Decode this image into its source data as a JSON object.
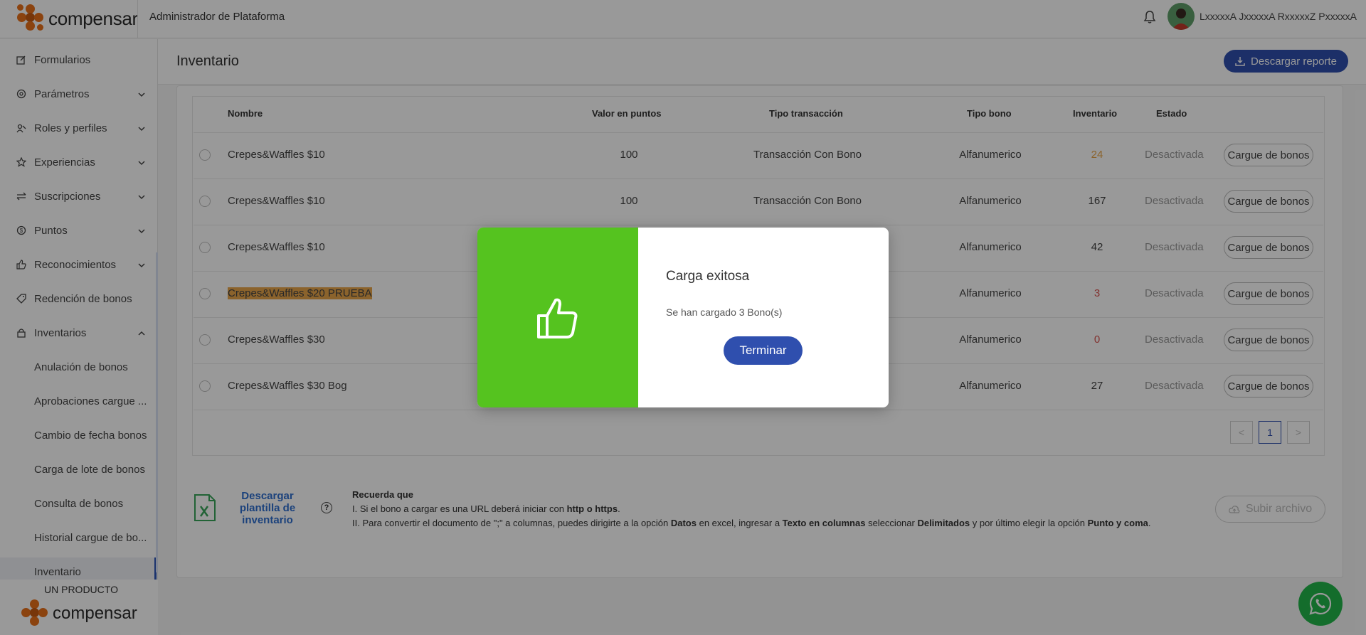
{
  "header": {
    "brand": "compensar",
    "app_title": "Administrador de Plataforma",
    "user_name": "LxxxxxA JxxxxxA RxxxxxZ PxxxxxA"
  },
  "sidebar": {
    "items": [
      {
        "label": "Formularios",
        "icon": "edit-icon"
      },
      {
        "label": "Parámetros",
        "icon": "gear-icon"
      },
      {
        "label": "Roles y perfiles",
        "icon": "users-icon"
      },
      {
        "label": "Experiencias",
        "icon": "star-icon"
      },
      {
        "label": "Suscripciones",
        "icon": "swap-icon"
      },
      {
        "label": "Puntos",
        "icon": "coin-icon"
      },
      {
        "label": "Reconocimientos",
        "icon": "thumbs-up-icon"
      },
      {
        "label": "Redención de bonos",
        "icon": "tag-icon"
      },
      {
        "label": "Inventarios",
        "icon": "lock-icon"
      }
    ],
    "subitems": [
      "Anulación de bonos",
      "Aprobaciones cargue ...",
      "Cambio de fecha bonos",
      "Carga de lote de bonos",
      "Consulta de bonos",
      "Historial cargue de bo...",
      "Inventario"
    ],
    "footer_label": "UN PRODUCTO",
    "footer_brand": "compensar"
  },
  "main": {
    "page_title": "Inventario",
    "download_report": "Descargar reporte",
    "columns": [
      "Nombre",
      "Valor en puntos",
      "Tipo transacción",
      "Tipo bono",
      "Inventario",
      "Estado"
    ],
    "rows": [
      {
        "name": "Crepes&Waffles $10",
        "points": "100",
        "transaction": "Transacción Con Bono",
        "bono_type": "Alfanumerico",
        "inventory": "24",
        "status": "Desactivada",
        "action": "Cargue de bonos"
      },
      {
        "name": "Crepes&Waffles $10",
        "points": "100",
        "transaction": "Transacción Con Bono",
        "bono_type": "Alfanumerico",
        "inventory": "167",
        "status": "Desactivada",
        "action": "Cargue de bonos"
      },
      {
        "name": "Crepes&Waffles $10",
        "points": "",
        "transaction": "",
        "bono_type": "Alfanumerico",
        "inventory": "42",
        "status": "Desactivada",
        "action": "Cargue de bonos"
      },
      {
        "name": "Crepes&Waffles $20 PRUEBA",
        "points": "",
        "transaction": "",
        "bono_type": "Alfanumerico",
        "inventory": "3",
        "status": "Desactivada",
        "action": "Cargue de bonos"
      },
      {
        "name": "Crepes&Waffles $30",
        "points": "",
        "transaction": "",
        "bono_type": "Alfanumerico",
        "inventory": "0",
        "status": "Desactivada",
        "action": "Cargue de bonos"
      },
      {
        "name": "Crepes&Waffles $30 Bog",
        "points": "",
        "transaction": "",
        "bono_type": "Alfanumerico",
        "inventory": "27",
        "status": "Desactivada",
        "action": "Cargue de bonos"
      }
    ],
    "pagination": {
      "prev": "<",
      "current": "1",
      "next": ">"
    },
    "template_link": "Descargar plantilla de inventario",
    "notes_title": "Recuerda que",
    "note1_pre": "I. Si el bono a cargar es una URL deberá iniciar con ",
    "note1_bold": "http o https",
    "note1_post": ".",
    "note2_a": "II. Para convertir el documento de \";\" a columnas, puedes dirigirte a la opción ",
    "note2_b": "Datos",
    "note2_c": " en excel, ingresar a ",
    "note2_d": "Texto en columnas",
    "note2_e": " seleccionar ",
    "note2_f": "Delimitados",
    "note2_g": " y por último elegir la opción ",
    "note2_h": "Punto y coma",
    "note2_i": ".",
    "upload_button": "Subir archivo"
  },
  "modal": {
    "title": "Carga exitosa",
    "message": "Se han cargado 3 Bono(s)",
    "button": "Terminar"
  },
  "colors": {
    "primary": "#2f4fae",
    "success": "#55c31f",
    "brand_orange": "#e8701a",
    "warning": "#e8a54a",
    "danger": "#d9534f"
  }
}
